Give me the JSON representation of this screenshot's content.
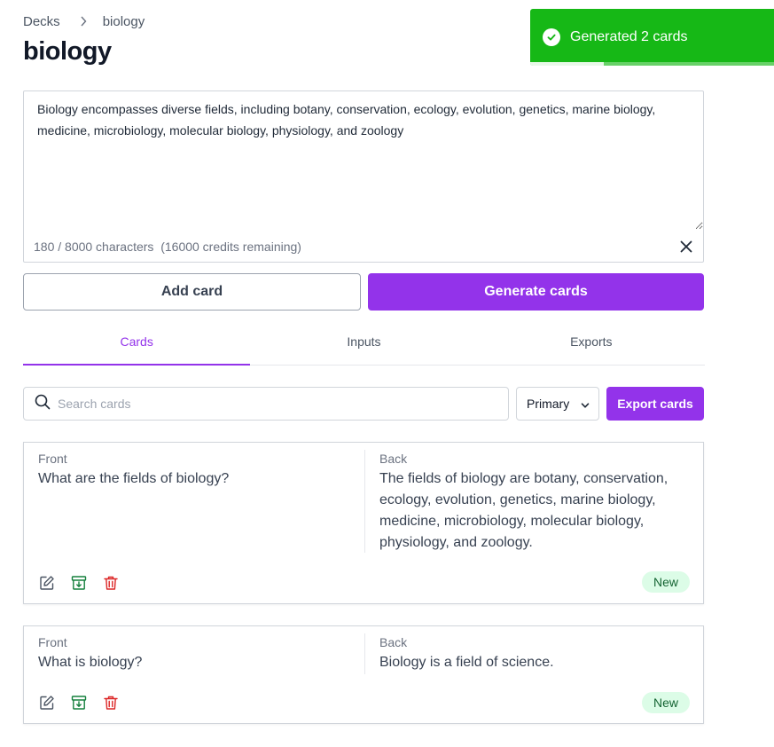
{
  "breadcrumb": {
    "root": "Decks",
    "current": "biology"
  },
  "page": {
    "title": "biology"
  },
  "toast": {
    "message": "Generated 2 cards",
    "progress": 0.3
  },
  "source_input": {
    "value": "Biology encompasses diverse fields, including botany, conservation, ecology, evolution, genetics, marine biology, medicine, microbiology, molecular biology, physiology, and zoology",
    "counter": "180 / 8000 characters",
    "credits": "(16000 credits remaining)"
  },
  "actions": {
    "add_card": "Add card",
    "generate_cards": "Generate cards"
  },
  "tabs": [
    {
      "label": "Cards",
      "active": true
    },
    {
      "label": "Inputs",
      "active": false
    },
    {
      "label": "Exports",
      "active": false
    }
  ],
  "toolbar": {
    "search_placeholder": "Search cards",
    "filter_selected": "Primary",
    "export_label": "Export cards"
  },
  "cards": [
    {
      "front_label": "Front",
      "front": "What are the fields of biology?",
      "back_label": "Back",
      "back": "The fields of biology are botany, conservation, ecology, evolution, genetics, marine biology, medicine, microbiology, molecular biology, physiology, and zoology.",
      "status": "New"
    },
    {
      "front_label": "Front",
      "front": "What is biology?",
      "back_label": "Back",
      "back": "Biology is a field of science.",
      "status": "New"
    }
  ],
  "colors": {
    "accent": "#9333ea",
    "toast": "#16b816",
    "archive_icon": "#15803d",
    "delete_icon": "#dc2626",
    "badge_bg": "#dcfce7"
  }
}
